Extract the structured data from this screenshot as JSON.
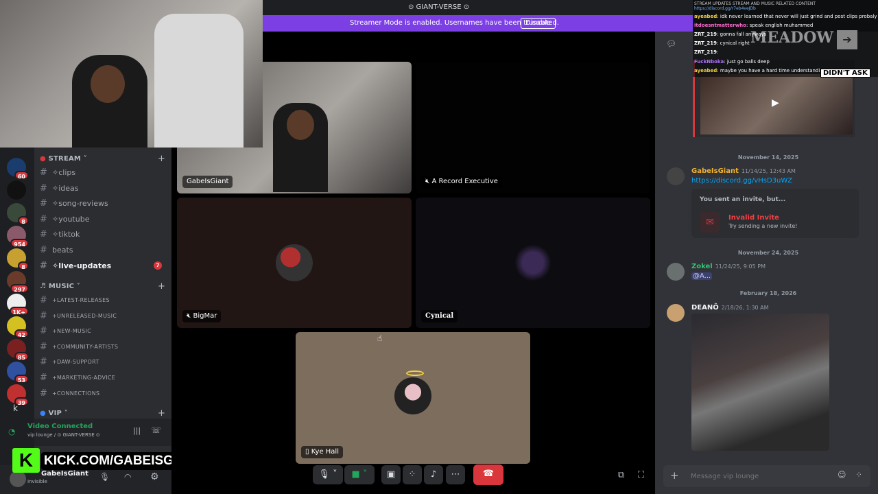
{
  "window": {
    "title": "⊙ GIANT-VERSE ⊙"
  },
  "streamer_mode": {
    "text": "Streamer Mode is enabled. Usernames have been truncated.",
    "disable_label": "Disable"
  },
  "servers": [
    {
      "badge": "60"
    },
    {
      "badge": ""
    },
    {
      "badge": "8"
    },
    {
      "badge": "954"
    },
    {
      "badge": "8"
    },
    {
      "badge": "297"
    },
    {
      "badge": "1K+"
    },
    {
      "badge": "42"
    },
    {
      "badge": "85"
    },
    {
      "badge": "53"
    },
    {
      "badge": "39"
    }
  ],
  "sidebar": {
    "stream_category": "STREAM",
    "stream_channels": [
      {
        "label": "✧clips"
      },
      {
        "label": "✧ideas"
      },
      {
        "label": "✧song-reviews"
      },
      {
        "label": "✧youtube"
      },
      {
        "label": "✧tiktok"
      },
      {
        "label": "beats"
      },
      {
        "label": "✧live-updates",
        "count": "7"
      }
    ],
    "music_category": "MUSIC",
    "music_channels": [
      {
        "label": "+LATEST-RELEASES"
      },
      {
        "label": "+UNRELEASED-MUSIC"
      },
      {
        "label": "+NEW-MUSIC"
      },
      {
        "label": "+COMMUNITY-ARTISTS"
      },
      {
        "label": "+DAW-SUPPORT"
      },
      {
        "label": "+MARKETING-ADVICE"
      },
      {
        "label": "+CONNECTIONS"
      }
    ],
    "vip_category": "VIP",
    "extra_letter": "k"
  },
  "voice": {
    "status": "Video Connected",
    "location": "vip lounge / ⊙ GIANT-VERSE ⊙"
  },
  "user": {
    "name": "GabeIsGiant",
    "status": "Invisible"
  },
  "kick_banner": "KICK.COM/GABEISGIANT",
  "tiles": [
    {
      "name": "GabeIsGiant"
    },
    {
      "name": "A Record Executive"
    },
    {
      "name": "BigMar"
    },
    {
      "name": "Cynical"
    },
    {
      "name": "Kye Hall"
    }
  ],
  "kick_chat": {
    "header": "STREAM UPDATES STREAM AND MUSIC RELATED CONTENT",
    "link": "https://discord.gg/r7eb4veJDb",
    "lines": [
      {
        "user": "ayeabed",
        "text": ": idk never learned that never will just grind and post clips probaly"
      },
      {
        "user": "itdoesntmatterwho",
        "text": ": speak english muhammed"
      },
      {
        "user": "ZRT_219",
        "text": ": gonna fall anyways"
      },
      {
        "user": "ZRT_219",
        "text": ": cynical right"
      },
      {
        "user": "ZRT_219",
        "text": ":"
      },
      {
        "user": "FuckNboka",
        "text": ": just go balls deep"
      },
      {
        "user": "ayeabed",
        "text": ": maybe you have a hard time understanding"
      }
    ],
    "overlay_word": "MEADOW",
    "sticker": "DIDN'T ASK"
  },
  "chat": {
    "date1": "November 14, 2025",
    "m1_author": "GabeIsGiant",
    "m1_time": "11/14/25, 12:43 AM",
    "m1_link": "https://discord.gg/vHsD3uWZ",
    "invite_header": "You sent an invite, but...",
    "invite_title": "Invalid Invite",
    "invite_sub": "Try sending a new invite!",
    "date2": "November 24, 2025",
    "m2_author": "Zokel",
    "m2_time": "11/24/25, 9:05 PM",
    "m2_text": "@A...",
    "date3": "February 18, 2026",
    "m3_author": "DEANÔ",
    "m3_time": "2/18/26, 1:30 AM",
    "input_placeholder": "Message vip lounge"
  },
  "colors": {
    "blurple": "#7b3fe4",
    "red": "#da373c",
    "green": "#23a55a",
    "link": "#00a8fc",
    "author_gabe": "#f0b232",
    "author_zokel": "#2dc770"
  }
}
